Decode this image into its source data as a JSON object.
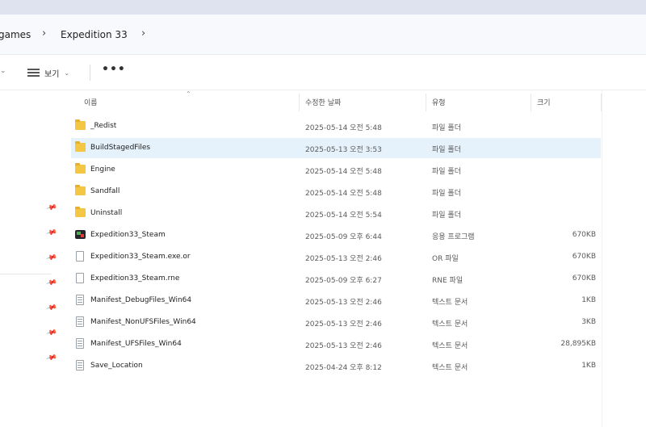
{
  "breadcrumb": {
    "items": [
      "games",
      "Expedition 33"
    ],
    "separator": "›"
  },
  "toolbar": {
    "view_label": "보기",
    "more_label": "•••"
  },
  "columns": {
    "name": "이름",
    "date": "수정한 날짜",
    "type": "유형",
    "size": "크기"
  },
  "files": [
    {
      "name": "_Redist",
      "date": "2025-05-14 오전 5:48",
      "type": "파일 폴더",
      "size": "",
      "icon": "folder-icon"
    },
    {
      "name": "BuildStagedFiles",
      "date": "2025-05-13 오전 3:53",
      "type": "파일 폴더",
      "size": "",
      "icon": "folder-icon",
      "selected": true
    },
    {
      "name": "Engine",
      "date": "2025-05-14 오전 5:48",
      "type": "파일 폴더",
      "size": "",
      "icon": "folder-icon"
    },
    {
      "name": "Sandfall",
      "date": "2025-05-14 오전 5:48",
      "type": "파일 폴더",
      "size": "",
      "icon": "folder-icon"
    },
    {
      "name": "Uninstall",
      "date": "2025-05-14 오전 5:54",
      "type": "파일 폴더",
      "size": "",
      "icon": "folder-icon"
    },
    {
      "name": "Expedition33_Steam",
      "date": "2025-05-09 오후 6:44",
      "type": "응용 프로그램",
      "size": "670KB",
      "icon": "application-icon"
    },
    {
      "name": "Expedition33_Steam.exe.or",
      "date": "2025-05-13 오전 2:46",
      "type": "OR 파일",
      "size": "670KB",
      "icon": "file-icon"
    },
    {
      "name": "Expedition33_Steam.rne",
      "date": "2025-05-09 오후 6:27",
      "type": "RNE 파일",
      "size": "670KB",
      "icon": "file-icon"
    },
    {
      "name": "Manifest_DebugFiles_Win64",
      "date": "2025-05-13 오전 2:46",
      "type": "텍스트 문서",
      "size": "1KB",
      "icon": "text-document-icon"
    },
    {
      "name": "Manifest_NonUFSFiles_Win64",
      "date": "2025-05-13 오전 2:46",
      "type": "텍스트 문서",
      "size": "3KB",
      "icon": "text-document-icon"
    },
    {
      "name": "Manifest_UFSFiles_Win64",
      "date": "2025-05-13 오전 2:46",
      "type": "텍스트 문서",
      "size": "28,895KB",
      "icon": "text-document-icon"
    },
    {
      "name": "Save_Location",
      "date": "2025-04-24 오후 8:12",
      "type": "텍스트 문서",
      "size": "1KB",
      "icon": "text-document-icon"
    }
  ],
  "colors": {
    "selection": "#e5f1fb",
    "folder": "#f3c744"
  }
}
